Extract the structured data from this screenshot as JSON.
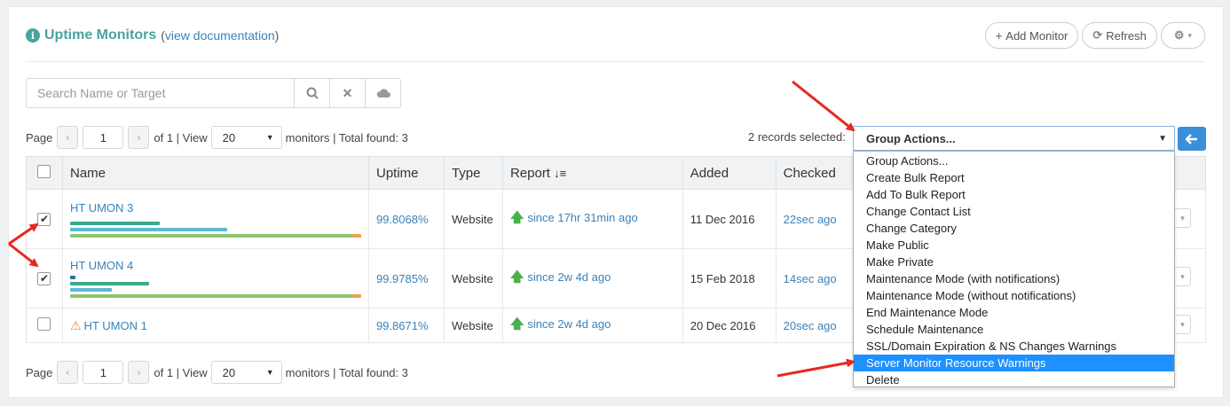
{
  "header": {
    "title": "Uptime Monitors",
    "doc_prefix": "(",
    "doc_link": "view documentation",
    "doc_suffix": ")",
    "add_monitor": "Add Monitor",
    "refresh": "Refresh"
  },
  "search": {
    "placeholder": "Search Name or Target"
  },
  "pager_top": {
    "page_label": "Page",
    "page": "1",
    "of_label": "of 1 | View",
    "per_page": "20",
    "total_text": "monitors | Total found: 3"
  },
  "pager_bottom": {
    "page_label": "Page",
    "page": "1",
    "of_label": "of 1 | View",
    "per_page": "20",
    "total_text": "monitors | Total found: 3"
  },
  "selection": {
    "text": "2 records selected:",
    "group_actions": "Group Actions..."
  },
  "table": {
    "headers": [
      "Name",
      "Uptime",
      "Type",
      "Report",
      "Added",
      "Checked"
    ],
    "report_sort_icon": "sort-desc-icon",
    "rows": [
      {
        "name": "HT UMON 3",
        "uptime": "99.8068%",
        "type": "Website",
        "since": "since 17hr 31min ago",
        "added": "11 Dec 2016",
        "checked": "22sec ago"
      },
      {
        "name": "HT UMON 4",
        "uptime": "99.9785%",
        "type": "Website",
        "since": "since 2w 4d ago",
        "added": "15 Feb 2018",
        "checked": "14sec ago"
      },
      {
        "name": "HT UMON 1",
        "uptime": "99.8671%",
        "type": "Website",
        "since": "since 2w 4d ago",
        "added": "20 Dec 2016",
        "checked": "20sec ago"
      }
    ]
  },
  "dropdown": {
    "options": [
      "Group Actions...",
      "Create Bulk Report",
      "Add To Bulk Report",
      "Change Contact List",
      "Change Category",
      "Make Public",
      "Make Private",
      "Maintenance Mode (with notifications)",
      "Maintenance Mode (without notifications)",
      "End Maintenance Mode",
      "Schedule Maintenance",
      "SSL/Domain Expiration & NS Changes Warnings",
      "Server Monitor Resource Warnings",
      "Delete"
    ],
    "highlighted": "Server Monitor Resource Warnings"
  },
  "colors": {
    "accent": "#4aa3a2",
    "link": "#3a82b8",
    "highlight": "#1e90ff",
    "annotation_arrow": "#e8281e"
  }
}
